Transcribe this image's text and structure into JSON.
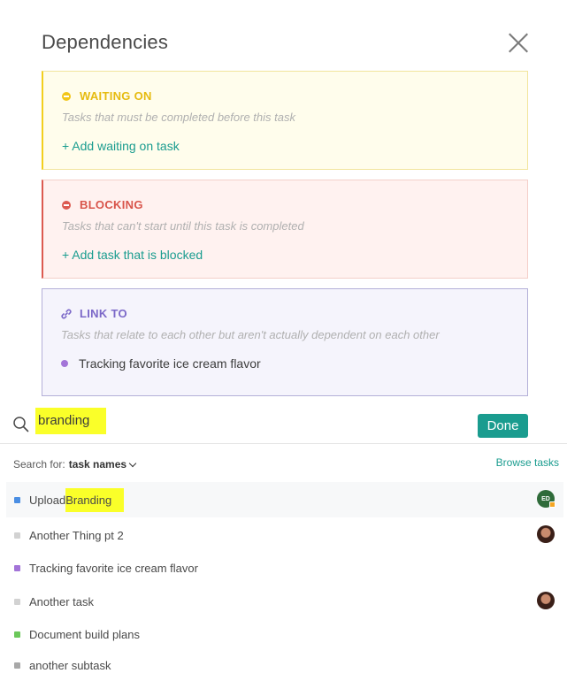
{
  "modal": {
    "title": "Dependencies"
  },
  "waiting_on": {
    "label": "WAITING ON",
    "description": "Tasks that must be completed before this task",
    "add_label": "+ Add waiting on task",
    "color": "#f2c618"
  },
  "blocking": {
    "label": "BLOCKING",
    "description": "Tasks that can't start until this task is completed",
    "add_label": "+ Add task that is blocked",
    "color": "#dc5a50"
  },
  "link_to": {
    "label": "LINK TO",
    "description": "Tasks that relate to each other but aren't actually dependent on each other",
    "items": [
      {
        "label": "Tracking favorite ice cream flavor",
        "color": "#a374d8"
      }
    ]
  },
  "search": {
    "value": "branding",
    "done_label": "Done",
    "search_for_label": "Search for:",
    "search_for_value": "task names",
    "browse_label": "Browse tasks"
  },
  "results": [
    {
      "prefix": "Upload ",
      "highlight": "Branding",
      "color": "#4a8ee3",
      "avatar": "ED",
      "icon": "avatar-initials"
    },
    {
      "label": "Another Thing pt 2",
      "color": "#d2d2d2",
      "icon": "avatar-photo"
    },
    {
      "label": "Tracking favorite ice cream flavor",
      "color": "#a374d8"
    },
    {
      "label": "Another task",
      "color": "#d2d2d2",
      "icon": "avatar-photo"
    },
    {
      "label": "Document build plans",
      "color": "#6bc85a"
    },
    {
      "label": "another subtask",
      "color": "#a8a8a8"
    }
  ]
}
